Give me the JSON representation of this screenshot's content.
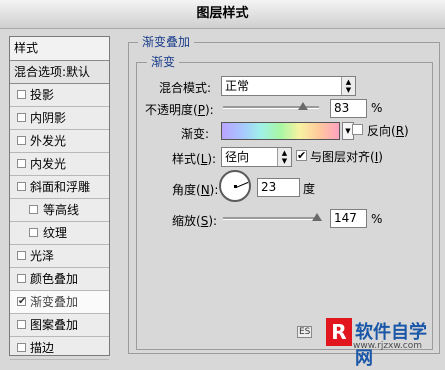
{
  "title": "图层样式",
  "styles_panel": {
    "header": "样式",
    "blending_options": "混合选项:默认",
    "items": [
      {
        "label": "投影",
        "checked": false,
        "sub": false
      },
      {
        "label": "内阴影",
        "checked": false,
        "sub": false
      },
      {
        "label": "外发光",
        "checked": false,
        "sub": false
      },
      {
        "label": "内发光",
        "checked": false,
        "sub": false
      },
      {
        "label": "斜面和浮雕",
        "checked": false,
        "sub": false
      },
      {
        "label": "等高线",
        "checked": false,
        "sub": true
      },
      {
        "label": "纹理",
        "checked": false,
        "sub": true
      },
      {
        "label": "光泽",
        "checked": false,
        "sub": false
      },
      {
        "label": "颜色叠加",
        "checked": false,
        "sub": false
      },
      {
        "label": "渐变叠加",
        "checked": true,
        "sub": false
      },
      {
        "label": "图案叠加",
        "checked": false,
        "sub": false
      },
      {
        "label": "描边",
        "checked": false,
        "sub": false
      }
    ]
  },
  "gradient_overlay": {
    "section_title": "渐变叠加",
    "group_title": "渐变",
    "blend_mode": {
      "label_pre": "混合模式:",
      "value": "正常"
    },
    "opacity": {
      "label_pre": "不透明度(",
      "key": "P",
      "label_post": "):",
      "value": "83",
      "unit": "%",
      "level": 0.83
    },
    "gradient": {
      "label": "渐变:",
      "reverse_pre": "反向(",
      "reverse_key": "R",
      "reverse_post": ")",
      "reverse_checked": false
    },
    "style": {
      "label_pre": "样式(",
      "key": "L",
      "label_post": "):",
      "value": "径向",
      "align_pre": "与图层对齐(",
      "align_key": "I",
      "align_post": ")",
      "align_checked": true
    },
    "angle": {
      "label_pre": "角度(",
      "key": "N",
      "label_post": "):",
      "value": "23",
      "unit": "度"
    },
    "scale": {
      "label_pre": "缩放(",
      "key": "S",
      "label_post": "):",
      "value": "147",
      "unit": "%",
      "level": 0.98
    }
  },
  "watermark": {
    "logo": "R",
    "text": "软件自学网",
    "url": "www.rjzxw.com"
  },
  "icons": {
    "es": "ES"
  }
}
